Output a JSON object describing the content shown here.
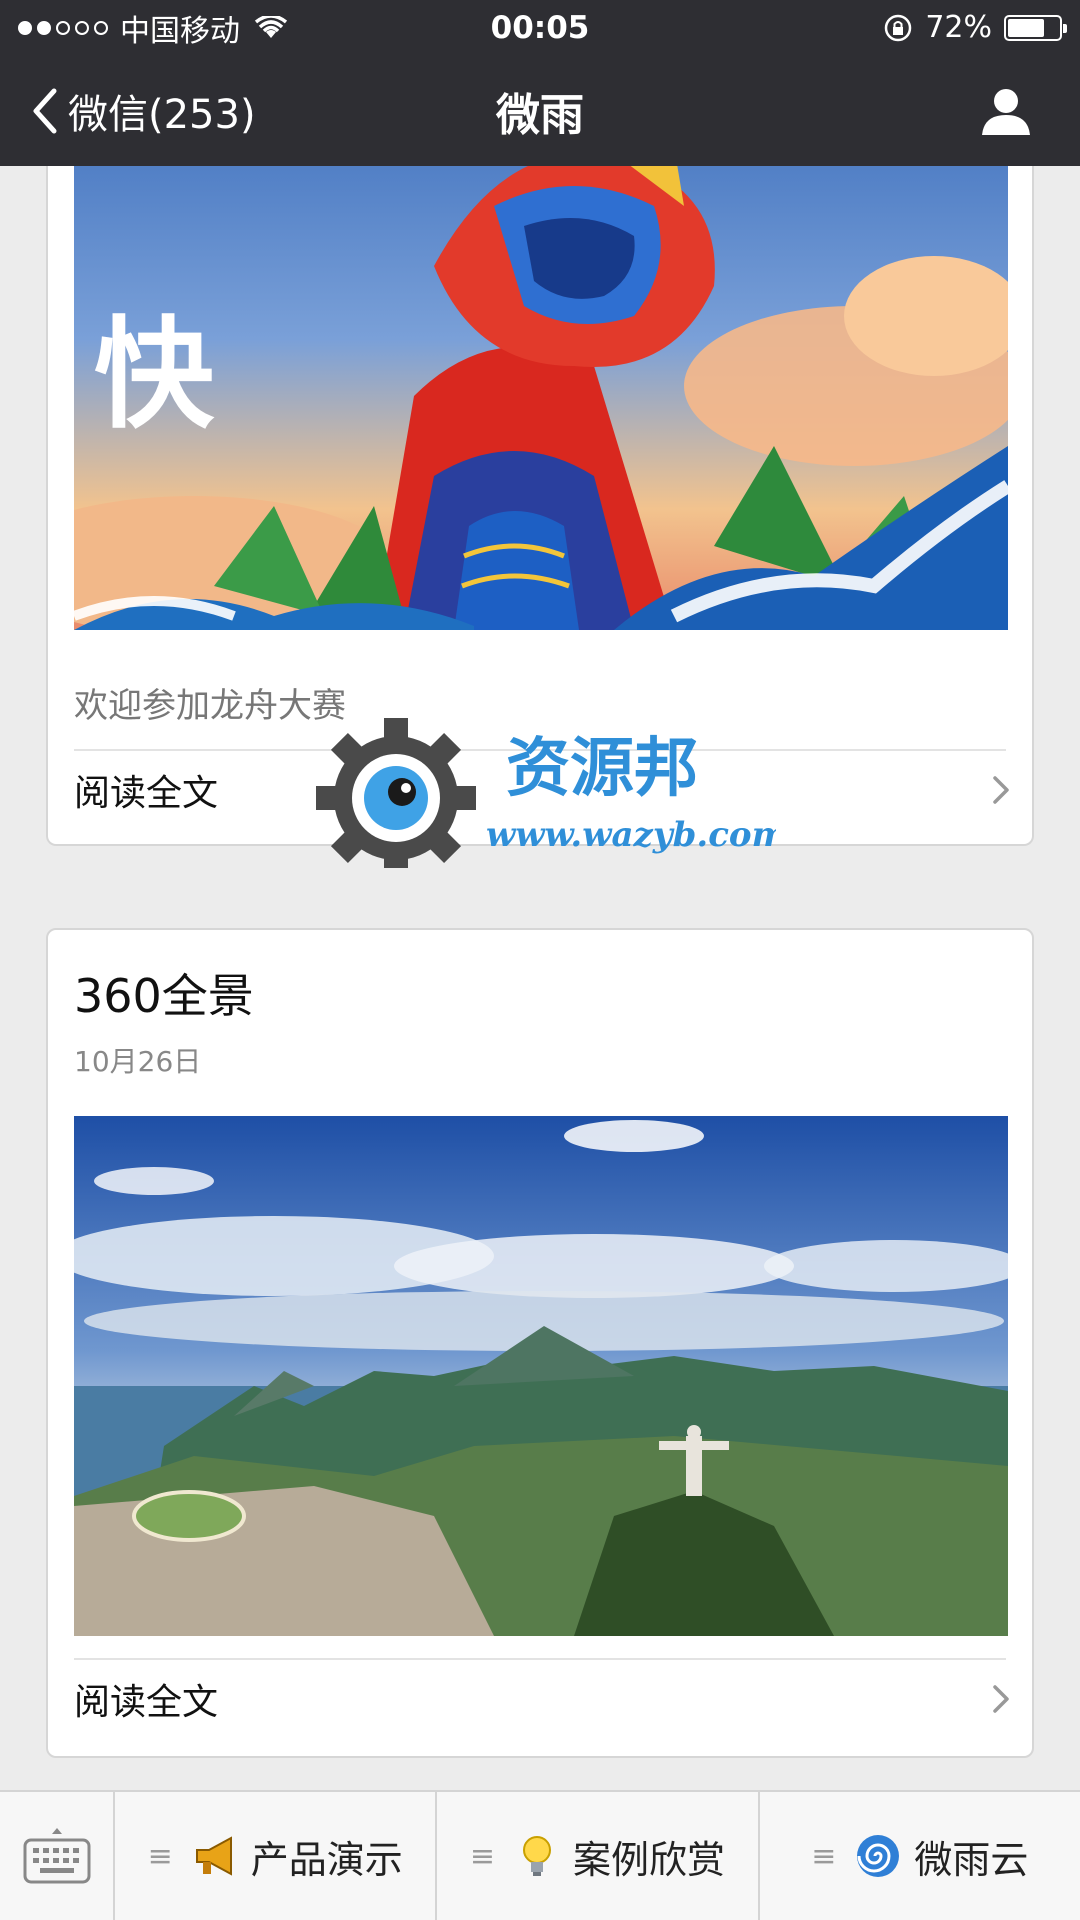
{
  "status_bar": {
    "carrier": "中国移动",
    "time": "00:05",
    "battery": "72%",
    "battery_level": 0.72
  },
  "nav": {
    "back_label": "微信(253)",
    "title": "微雨"
  },
  "cards": [
    {
      "summary": "欢迎参加龙舟大赛",
      "banner_text": "快",
      "read_more": "阅读全文"
    },
    {
      "title": "360全景",
      "date": "10月26日",
      "read_more": "阅读全文"
    }
  ],
  "watermark": {
    "name": "资源邦",
    "url": "www.wazyb.com"
  },
  "bottom_menu": {
    "items": [
      {
        "label": "产品演示",
        "icon": "megaphone-icon"
      },
      {
        "label": "案例欣赏",
        "icon": "lightbulb-icon"
      },
      {
        "label": "微雨云",
        "icon": "spiral-icon"
      }
    ]
  },
  "colors": {
    "bar_bg": "#2e2e33",
    "page_bg": "#ececec",
    "watermark_blue": "#2f8fd8"
  }
}
